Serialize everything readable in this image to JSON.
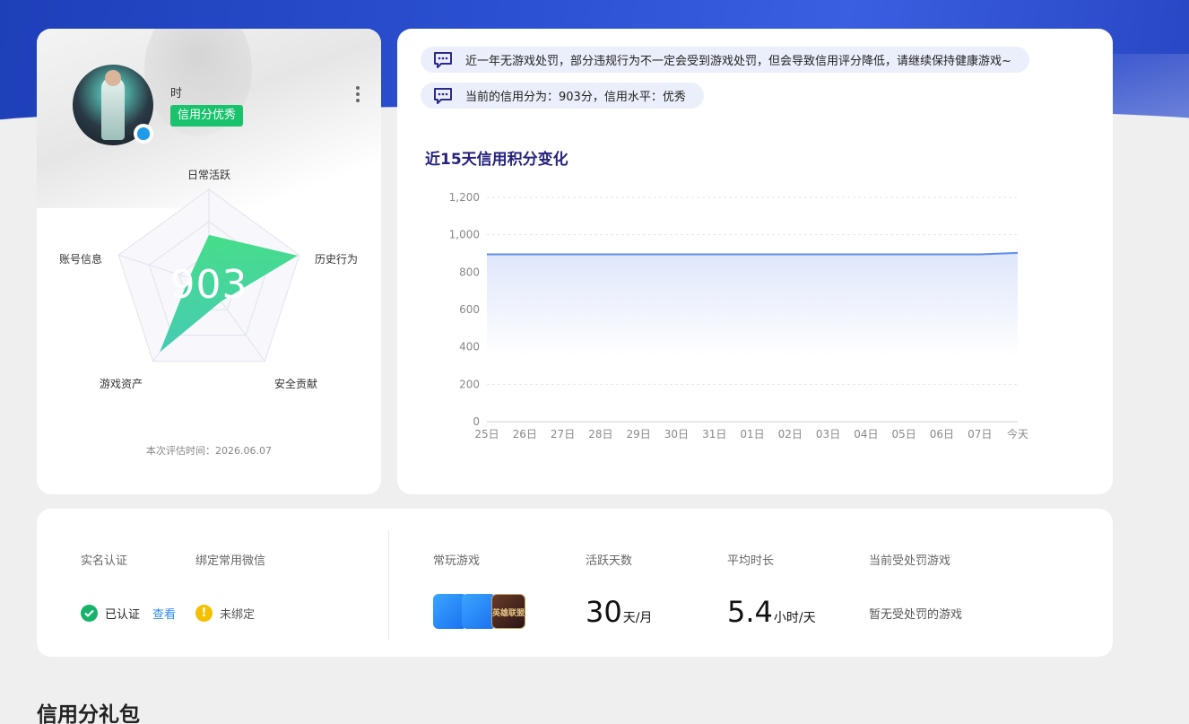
{
  "profile": {
    "username": "时",
    "credit_tag": "信用分优秀",
    "score": "903",
    "eval_time": "本次评估时间：2026.06.07",
    "radar": {
      "axes": [
        "日常活跃",
        "历史行为",
        "安全贡献",
        "游戏资产",
        "账号信息"
      ],
      "values": [
        0.52,
        0.98,
        0.22,
        0.88,
        0.22
      ],
      "fill_color": "#3ddc84"
    }
  },
  "notices": [
    "近一年无游戏处罚，部分违规行为不一定会受到游戏处罚，但会导致信用评分降低，请继续保持健康游戏~",
    "当前的信用分为：903分，信用水平：优秀"
  ],
  "chart_title": "近15天信用积分变化",
  "chart_data": {
    "type": "area",
    "categories": [
      "25日",
      "26日",
      "27日",
      "28日",
      "29日",
      "30日",
      "31日",
      "01日",
      "02日",
      "03日",
      "04日",
      "05日",
      "06日",
      "07日",
      "今天"
    ],
    "values": [
      895,
      895,
      895,
      895,
      895,
      895,
      895,
      895,
      895,
      895,
      895,
      895,
      895,
      895,
      903
    ],
    "yticks": [
      "0",
      "200",
      "400",
      "600",
      "800",
      "1,000",
      "1,200"
    ],
    "ylim": [
      0,
      1200
    ],
    "line_color": "#5b8def",
    "title": "近15天信用积分变化",
    "xlabel": "",
    "ylabel": ""
  },
  "stats": {
    "real_name_label": "实名认证",
    "real_name_status": "已认证",
    "view_link": "查看",
    "wechat_label": "绑定常用微信",
    "wechat_status": "未绑定",
    "games_label": "常玩游戏",
    "lol_icon_text": "英雄联盟",
    "active_days_label": "活跃天数",
    "active_days_value": "30",
    "active_days_unit": "天/月",
    "avg_time_label": "平均时长",
    "avg_time_value": "5.4",
    "avg_time_unit": "小时/天",
    "punished_label": "当前受处罚游戏",
    "punished_value": "暂无受处罚的游戏"
  },
  "gift_title": "信用分礼包"
}
